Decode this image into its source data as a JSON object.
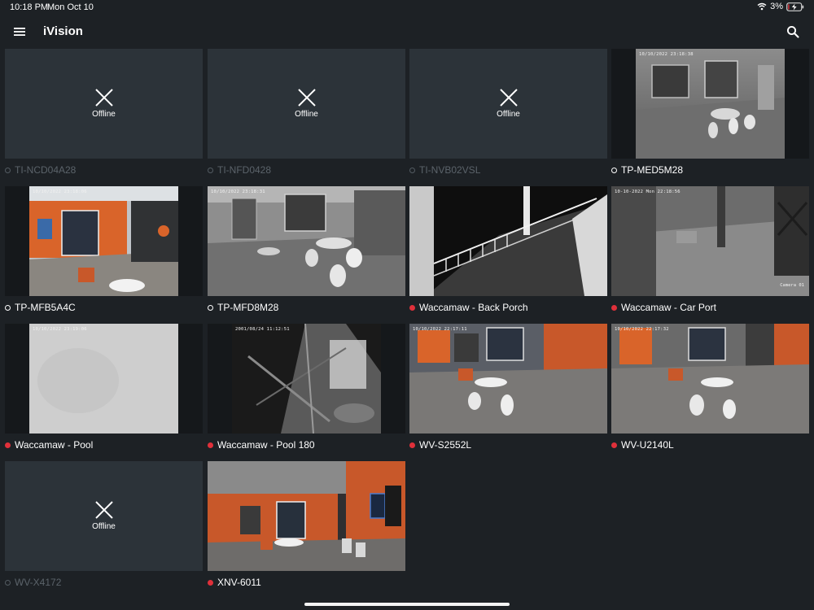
{
  "status_bar": {
    "time": "10:18 PM",
    "date": "Mon Oct 10",
    "battery": "3%"
  },
  "app": {
    "title": "iVision"
  },
  "offline_text": "Offline",
  "cameras": [
    {
      "name": "TI-NCD04A28",
      "status": "offline"
    },
    {
      "name": "TI-NFD0428",
      "status": "offline"
    },
    {
      "name": "TI-NVB02VSL",
      "status": "offline"
    },
    {
      "name": "TP-MED5M28",
      "status": "online",
      "indicator": "ring",
      "timestamp": "10/10/2022 23:18:38"
    },
    {
      "name": "TP-MFB5A4C",
      "status": "online",
      "indicator": "ring",
      "timestamp": "10/10/2022 23:18:06"
    },
    {
      "name": "TP-MFD8M28",
      "status": "online",
      "indicator": "ring",
      "timestamp": "10/10/2022 23:18:31"
    },
    {
      "name": "Waccamaw - Back Porch",
      "status": "online",
      "indicator": "red"
    },
    {
      "name": "Waccamaw - Car Port",
      "status": "online",
      "indicator": "red",
      "timestamp": "10-10-2022 Mon 22:18:56",
      "overlay": "Camera 01"
    },
    {
      "name": "Waccamaw - Pool",
      "status": "online",
      "indicator": "red",
      "timestamp": "10/10/2022 23:19:06"
    },
    {
      "name": "Waccamaw - Pool 180",
      "status": "online",
      "indicator": "red",
      "timestamp": "2001/08/24 11:12:51"
    },
    {
      "name": "WV-S2552L",
      "status": "online",
      "indicator": "red",
      "timestamp": "10/10/2022 22:17:11"
    },
    {
      "name": "WV-U2140L",
      "status": "online",
      "indicator": "red",
      "timestamp": "10/10/2022 22:17:32"
    },
    {
      "name": "WV-X4172",
      "status": "offline"
    },
    {
      "name": "XNV-6011",
      "status": "online",
      "indicator": "red"
    }
  ],
  "colors": {
    "background": "#1d2125",
    "tile": "#2c3339",
    "offline_text": "#5b636a",
    "live_dot": "#e0303a",
    "accent_orange": "#d9642a"
  }
}
